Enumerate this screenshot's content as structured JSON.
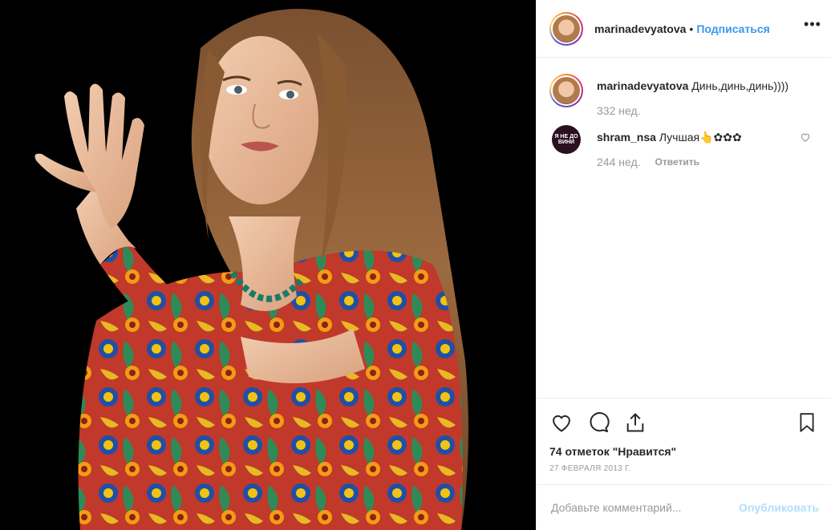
{
  "post": {
    "username": "marinadevyatova",
    "dot": "•",
    "follow_label": "Подписаться",
    "more_label": "•••"
  },
  "comments": [
    {
      "username": "marinadevyatova",
      "text": "Динь,динь,динь))))",
      "age": "332 нед."
    },
    {
      "username": "shram_nsa",
      "text": "Лучшая👆✿✿✿",
      "age": "244 нед.",
      "reply_label": "Ответить",
      "avatar_text": "Я НЕ ДО ВИНИ"
    }
  ],
  "actions": {
    "likes": "74 отметок \"Нравится\"",
    "date": "27 ФЕВРАЛЯ 2013 Г."
  },
  "add_comment": {
    "placeholder": "Добавьте комментарий...",
    "publish_label": "Опубликовать"
  },
  "colors": {
    "accent": "#3897f0",
    "publish_disabled": "#b2dffc",
    "muted": "#999999",
    "border": "#efefef"
  },
  "icons": [
    "heart-icon",
    "comment-icon",
    "share-icon",
    "bookmark-icon",
    "more-icon",
    "heart-small-icon"
  ]
}
